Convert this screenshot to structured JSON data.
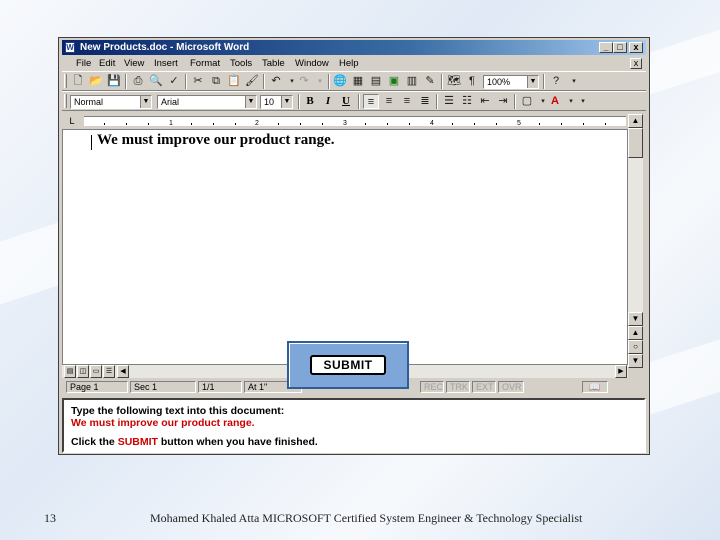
{
  "window": {
    "title": "New Products.doc - Microsoft Word",
    "controls": {
      "minimize": "_",
      "maximize": "□",
      "close": "x"
    }
  },
  "menubar": {
    "items": [
      "File",
      "Edit",
      "View",
      "Insert",
      "Format",
      "Tools",
      "Table",
      "Window",
      "Help"
    ],
    "doc_close": "x"
  },
  "standard_toolbar": {
    "zoom": "100%",
    "icons": [
      "new-icon",
      "open-icon",
      "save-icon",
      "print-icon",
      "print-preview-icon",
      "spelling-icon",
      "cut-icon",
      "copy-icon",
      "paste-icon",
      "format-painter-icon",
      "undo-icon",
      "redo-icon",
      "hyperlink-icon",
      "tables-borders-icon",
      "insert-table-icon",
      "insert-excel-icon",
      "columns-icon",
      "drawing-icon",
      "document-map-icon",
      "show-hide-icon",
      "help-icon"
    ]
  },
  "formatting_toolbar": {
    "style": "Normal",
    "font": "Arial",
    "size": "10",
    "bold": "B",
    "italic": "I",
    "underline": "U"
  },
  "ruler": {
    "numbers": [
      "1",
      "2",
      "3",
      "4",
      "5"
    ]
  },
  "document": {
    "text": "We must improve our product range."
  },
  "status_bar": {
    "page": "Page 1",
    "section": "Sec 1",
    "pages": "1/1",
    "at": "At 1\"",
    "rec": "REC",
    "trk": "TRK",
    "ext": "EXT",
    "ovr": "OVR"
  },
  "submit": {
    "label": "SUBMIT"
  },
  "instructions": {
    "line1": "Type the following text into this document:",
    "line2": "We must improve our product range.",
    "line3_prefix": "Click the",
    "line3_highlight": "SUBMIT",
    "line3_suffix": "button when you have finished."
  },
  "footer": {
    "page_number": "13",
    "text": "Mohamed Khaled Atta MICROSOFT Certified System Engineer & Technology Specialist"
  },
  "colors": {
    "title_bar": "#0a246a",
    "instruction_red": "#cc0000",
    "submit_panel": "#7ea6d8"
  }
}
